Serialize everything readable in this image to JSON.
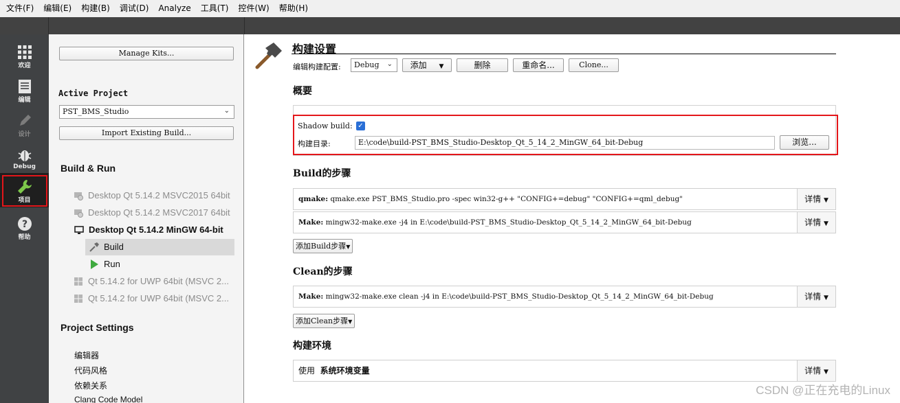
{
  "menu": [
    "文件(F)",
    "编辑(E)",
    "构建(B)",
    "调试(D)",
    "Analyze",
    "工具(T)",
    "控件(W)",
    "帮助(H)"
  ],
  "modes": [
    {
      "label": "欢迎",
      "icon": "grid-icon",
      "state": "normal"
    },
    {
      "label": "编辑",
      "icon": "document-icon",
      "state": "normal"
    },
    {
      "label": "设计",
      "icon": "pencil-icon",
      "state": "disabled"
    },
    {
      "label": "Debug",
      "icon": "bug-icon",
      "state": "normal"
    },
    {
      "label": "项目",
      "icon": "wrench-icon",
      "state": "active"
    },
    {
      "label": "帮助",
      "icon": "question-icon",
      "state": "normal"
    }
  ],
  "project": {
    "manage_kits": "Manage Kits...",
    "active_project_heading": "Active Project",
    "active_project_value": "PST_BMS_Studio",
    "import_build": "Import Existing Build...",
    "build_run_heading": "Build & Run",
    "kits": [
      {
        "label": "Desktop Qt 5.14.2 MSVC2015 64bit",
        "icon": "kit-disabled-icon",
        "state": "disabled"
      },
      {
        "label": "Desktop Qt 5.14.2 MSVC2017 64bit",
        "icon": "kit-disabled-icon",
        "state": "disabled"
      },
      {
        "label": "Desktop Qt 5.14.2 MinGW 64-bit",
        "icon": "monitor-icon",
        "state": "current"
      }
    ],
    "kit_subitems": [
      {
        "label": "Build",
        "icon": "hammer-icon",
        "selected": true
      },
      {
        "label": "Run",
        "icon": "run-triangle-icon",
        "selected": false
      }
    ],
    "uwp_kits": [
      {
        "label": "Qt 5.14.2 for UWP 64bit (MSVC 2...",
        "icon": "windows-icon"
      },
      {
        "label": "Qt 5.14.2 for UWP 64bit (MSVC 2...",
        "icon": "windows-icon"
      }
    ],
    "project_settings_heading": "Project Settings",
    "settings": [
      "编辑器",
      "代码风格",
      "依赖关系",
      "Clang Code Model"
    ]
  },
  "build": {
    "title": "构建设置",
    "edit_config_label": "编辑构建配置:",
    "config_value": "Debug",
    "add_label": "添加",
    "delete_label": "删除",
    "rename_label": "重命名...",
    "clone_label": "Clone...",
    "overview_heading": "概要",
    "shadow_build_label": "Shadow build:",
    "shadow_build_checked": true,
    "build_dir_label": "构建目录:",
    "build_dir_value": "E:\\code\\build-PST_BMS_Studio-Desktop_Qt_5_14_2_MinGW_64_bit-Debug",
    "browse_label": "浏览...",
    "build_steps_heading": "Build的步骤",
    "build_steps": [
      {
        "name": "qmake:",
        "cmd": "qmake.exe PST_BMS_Studio.pro -spec win32-g++ \"CONFIG+=debug\" \"CONFIG+=qml_debug\""
      },
      {
        "name": "Make:",
        "cmd": "mingw32-make.exe -j4 in E:\\code\\build-PST_BMS_Studio-Desktop_Qt_5_14_2_MinGW_64_bit-Debug"
      }
    ],
    "add_build_step": "添加Build步骤",
    "clean_steps_heading": "Clean的步骤",
    "clean_steps": [
      {
        "name": "Make:",
        "cmd": "mingw32-make.exe clean -j4 in E:\\code\\build-PST_BMS_Studio-Desktop_Qt_5_14_2_MinGW_64_bit-Debug"
      }
    ],
    "add_clean_step": "添加Clean步骤",
    "env_heading": "构建环境",
    "env_use": "使用",
    "env_value": "系统环境变量",
    "details_label": "详情"
  },
  "watermark": "CSDN @正在充电的Linux",
  "colors": {
    "accent": "#2a6fd6",
    "highlight_red": "#e4161a",
    "mode_bg": "#404244",
    "active_icon": "#7dc84a"
  }
}
